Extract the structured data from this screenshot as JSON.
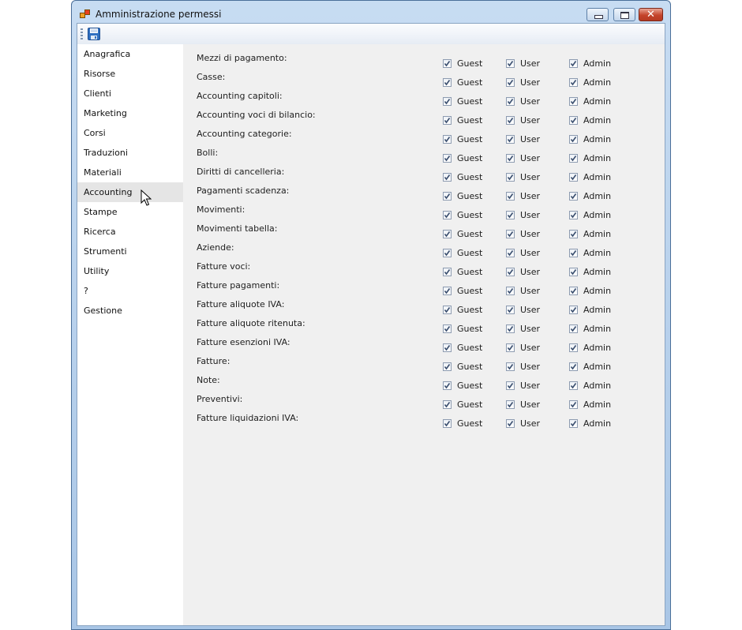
{
  "window": {
    "title": "Amministrazione permessi",
    "close_glyph": "✕"
  },
  "toolbar": {
    "save_icon": "floppy-disk-icon"
  },
  "sidebar": {
    "items": [
      {
        "label": "Anagrafica"
      },
      {
        "label": "Risorse"
      },
      {
        "label": "Clienti"
      },
      {
        "label": "Marketing"
      },
      {
        "label": "Corsi"
      },
      {
        "label": "Traduzioni"
      },
      {
        "label": "Materiali"
      },
      {
        "label": "Accounting",
        "hovered": true
      },
      {
        "label": "Stampe"
      },
      {
        "label": "Ricerca"
      },
      {
        "label": "Strumenti"
      },
      {
        "label": "Utility"
      },
      {
        "label": "?"
      },
      {
        "label": "Gestione"
      }
    ]
  },
  "roles": [
    "Guest",
    "User",
    "Admin"
  ],
  "permissions": [
    {
      "label": "Mezzi di pagamento:",
      "guest": true,
      "user": true,
      "admin": true
    },
    {
      "label": "Casse:",
      "guest": true,
      "user": true,
      "admin": true
    },
    {
      "label": "Accounting capitoli:",
      "guest": true,
      "user": true,
      "admin": true
    },
    {
      "label": "Accounting voci di bilancio:",
      "guest": true,
      "user": true,
      "admin": true
    },
    {
      "label": "Accounting categorie:",
      "guest": true,
      "user": true,
      "admin": true
    },
    {
      "label": "Bolli:",
      "guest": true,
      "user": true,
      "admin": true
    },
    {
      "label": "Diritti di cancelleria:",
      "guest": true,
      "user": true,
      "admin": true
    },
    {
      "label": "Pagamenti scadenza:",
      "guest": true,
      "user": true,
      "admin": true
    },
    {
      "label": "Movimenti:",
      "guest": true,
      "user": true,
      "admin": true
    },
    {
      "label": "Movimenti tabella:",
      "guest": true,
      "user": true,
      "admin": true
    },
    {
      "label": "Aziende:",
      "guest": true,
      "user": true,
      "admin": true
    },
    {
      "label": "Fatture voci:",
      "guest": true,
      "user": true,
      "admin": true
    },
    {
      "label": "Fatture pagamenti:",
      "guest": true,
      "user": true,
      "admin": true
    },
    {
      "label": "Fatture aliquote IVA:",
      "guest": true,
      "user": true,
      "admin": true
    },
    {
      "label": "Fatture aliquote ritenuta:",
      "guest": true,
      "user": true,
      "admin": true
    },
    {
      "label": "Fatture esenzioni IVA:",
      "guest": true,
      "user": true,
      "admin": true
    },
    {
      "label": "Fatture:",
      "guest": true,
      "user": true,
      "admin": true
    },
    {
      "label": "Note:",
      "guest": true,
      "user": true,
      "admin": true
    },
    {
      "label": "Preventivi:",
      "guest": true,
      "user": true,
      "admin": true
    },
    {
      "label": "Fatture liquidazioni IVA:",
      "guest": true,
      "user": true,
      "admin": true
    }
  ],
  "colors": {
    "check_mark": "#3a4e6e",
    "save_icon_blue": "#2f6fc0"
  }
}
